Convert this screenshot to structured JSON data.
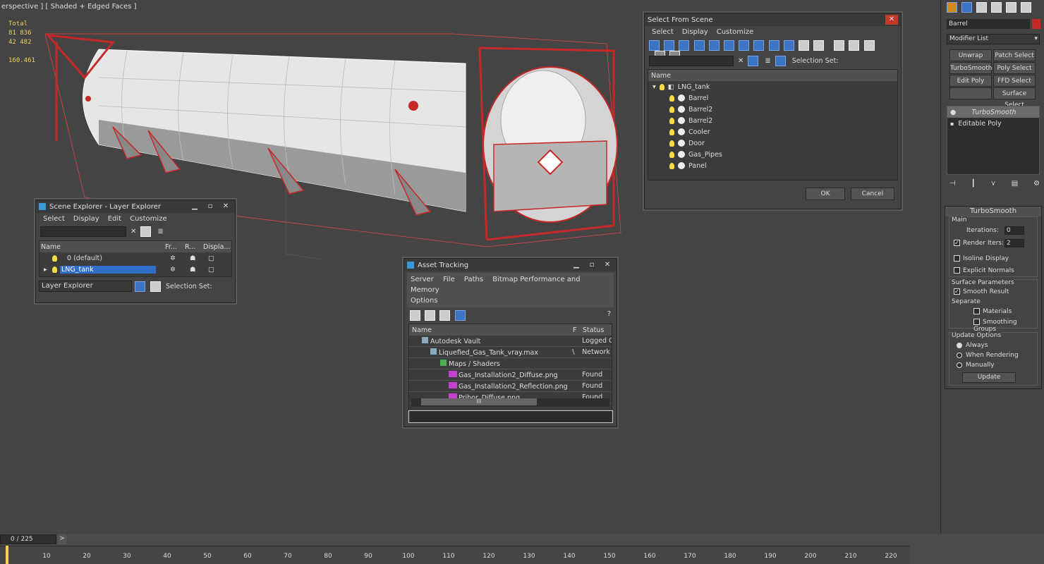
{
  "viewport": {
    "label": "erspective ] [ Shaded + Edged Faces ]",
    "stats": {
      "total_label": "Total",
      "polys": "81 836",
      "verts": "42 482",
      "fps": "160.461"
    }
  },
  "select_from_scene": {
    "title": "Select From Scene",
    "menu": [
      "Select",
      "Display",
      "Customize"
    ],
    "selection_set_label": "Selection Set:",
    "column_name": "Name",
    "root": "LNG_tank",
    "items": [
      "Barrel",
      "Barrel2",
      "Barrel2",
      "Cooler",
      "Door",
      "Gas_Pipes",
      "Panel"
    ],
    "ok": "OK",
    "cancel": "Cancel"
  },
  "scene_explorer": {
    "title": "Scene Explorer - Layer Explorer",
    "menu": [
      "Select",
      "Display",
      "Edit",
      "Customize"
    ],
    "columns": [
      "Name",
      "Fr...",
      "R...",
      "Displa..."
    ],
    "layers": [
      "0 (default)",
      "LNG_tank"
    ],
    "footer_dropdown": "Layer Explorer",
    "selection_set_label": "Selection Set:"
  },
  "asset_tracking": {
    "title": "Asset Tracking",
    "menu": [
      "Server",
      "File",
      "Paths",
      "Bitmap Performance and Memory",
      "Options"
    ],
    "columns": [
      "Name",
      "F",
      "Status"
    ],
    "rows": [
      {
        "name": "Autodesk Vault",
        "f": "",
        "status": "Logged O"
      },
      {
        "name": "Liquefied_Gas_Tank_vray.max",
        "f": "\\",
        "status": "Network I"
      },
      {
        "name": "Maps / Shaders",
        "f": "",
        "status": ""
      },
      {
        "name": "Gas_Installation2_Diffuse.png",
        "f": "",
        "status": "Found"
      },
      {
        "name": "Gas_Installation2_Reflection.png",
        "f": "",
        "status": "Found"
      },
      {
        "name": "Pribor_Diffuse.png",
        "f": "",
        "status": "Found"
      }
    ],
    "scroll_grip": "III"
  },
  "command_panel": {
    "object_name": "Barrel",
    "modifier_list": "Modifier List",
    "buttons": [
      "Unwrap UVW",
      "Patch Select",
      "TurboSmooth",
      "Poly Select",
      "Edit Poly",
      "FFD Select",
      "",
      "Surface Select"
    ],
    "stack": [
      "TurboSmooth",
      "Editable Poly"
    ],
    "rollout_title": "TurboSmooth",
    "main_label": "Main",
    "iterations_label": "Iterations:",
    "iterations_value": "0",
    "render_iters_label": "Render Iters:",
    "render_iters_value": "2",
    "isoline_label": "Isoline Display",
    "explicit_normals_label": "Explicit Normals",
    "surface_params_label": "Surface Parameters",
    "smooth_result_label": "Smooth Result",
    "separate_label": "Separate",
    "materials_label": "Materials",
    "smoothing_groups_label": "Smoothing Groups",
    "update_options_label": "Update Options",
    "always_label": "Always",
    "when_rendering_label": "When Rendering",
    "manually_label": "Manually",
    "update_button": "Update"
  },
  "timeline": {
    "frame": "0 / 225",
    "next": ">",
    "ticks": [
      "10",
      "20",
      "30",
      "40",
      "50",
      "60",
      "70",
      "80",
      "90",
      "100",
      "110",
      "120",
      "130",
      "140",
      "150",
      "160",
      "170",
      "180",
      "190",
      "200",
      "210",
      "220"
    ]
  },
  "colors": {
    "accent_blue": "#3b74c5",
    "selection_red": "#c62828",
    "stats_yellow": "#f0d060"
  }
}
